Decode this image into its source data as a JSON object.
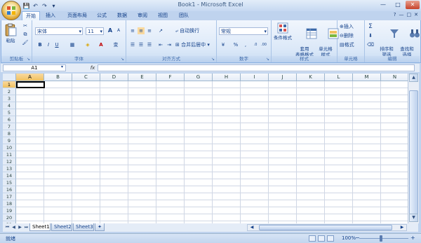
{
  "window": {
    "title": "Book1 - Microsoft Excel"
  },
  "window_controls": {
    "minimize": "—",
    "maximize": "□",
    "close": "✕"
  },
  "doc_controls": {
    "help": "?",
    "minimize": "—",
    "restore": "□",
    "close": "✕"
  },
  "qat": {
    "save": "💾",
    "undo": "↶",
    "redo": "↷",
    "customize": "▾"
  },
  "tabs": [
    {
      "label": "开始",
      "active": true
    },
    {
      "label": "插入"
    },
    {
      "label": "页面布局"
    },
    {
      "label": "公式"
    },
    {
      "label": "数据"
    },
    {
      "label": "审阅"
    },
    {
      "label": "视图"
    },
    {
      "label": "团队"
    }
  ],
  "ribbon": {
    "clipboard": {
      "label": "剪贴板",
      "paste": "粘贴"
    },
    "font": {
      "label": "字体",
      "font_name": "宋体",
      "font_size": "11",
      "bold": "B",
      "italic": "I",
      "underline": "U",
      "grow": "A",
      "shrink": "A",
      "font_color_glyph": "A",
      "phonetic": "变"
    },
    "alignment": {
      "label": "对齐方式",
      "wrap": "自动换行",
      "merge": "合并后居中"
    },
    "number": {
      "label": "数字",
      "format": "常规",
      "percent": "%",
      "comma": ",",
      "currency": "¥"
    },
    "styles": {
      "label": "样式",
      "conditional": "条件格式",
      "table_format": "套用\n表格格式",
      "cell_styles": "单元格\n样式"
    },
    "cells": {
      "label": "单元格",
      "insert": "插入",
      "delete": "删除",
      "format": "格式"
    },
    "editing": {
      "label": "编辑",
      "sum": "Σ",
      "sort": "排序和\n筛选",
      "find": "查找和\n选择"
    }
  },
  "formula_bar": {
    "name_box": "A1",
    "fx": "fx",
    "value": ""
  },
  "columns": [
    "A",
    "B",
    "C",
    "D",
    "E",
    "F",
    "G",
    "H",
    "I",
    "J",
    "K",
    "L",
    "M",
    "N"
  ],
  "rows": [
    "1",
    "2",
    "3",
    "4",
    "5",
    "6",
    "7",
    "8",
    "9",
    "10",
    "11",
    "12",
    "13",
    "14",
    "15",
    "16",
    "17",
    "18",
    "19",
    "20",
    "21"
  ],
  "sheets": [
    {
      "label": "Sheet1",
      "active": true
    },
    {
      "label": "Sheet2"
    },
    {
      "label": "Sheet3"
    }
  ],
  "status": {
    "text": "就绪",
    "zoom": "100%",
    "zoom_minus": "−",
    "zoom_plus": "+"
  },
  "colors": {
    "ribbon_bg": "#dbe8f8",
    "header_bg": "#e4ecf7",
    "grid_line": "#d0d7e5",
    "selection": "#f1c15f"
  }
}
